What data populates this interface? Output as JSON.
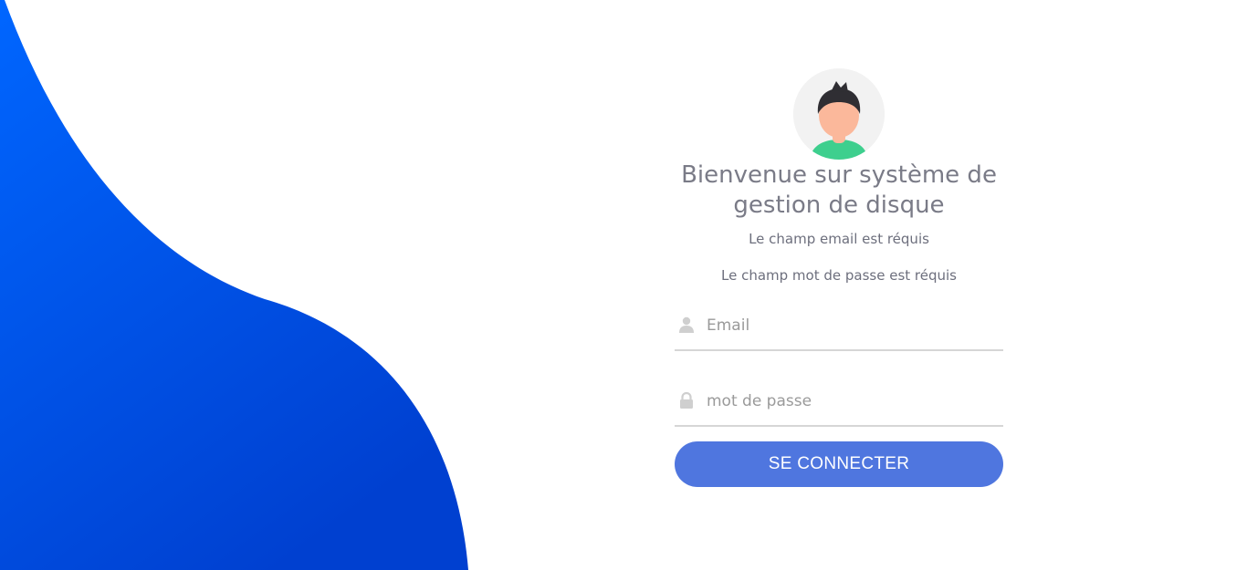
{
  "colors": {
    "wave_light": "#0066ff",
    "wave_dark": "#0040d0",
    "button": "#4f76df",
    "title_text": "#7a7b87",
    "input_border": "#d6d6d6",
    "avatar_bg": "#f2f2f2",
    "avatar_skin": "#fbb89b",
    "avatar_hair": "#2f2e33",
    "avatar_shirt": "#3ecf8e"
  },
  "login": {
    "avatar_icon": "user-avatar-icon",
    "title": "Bienvenue sur système de gestion de disque",
    "errors": {
      "email": "Le champ email est réquis",
      "password": "Le champ mot de passe est réquis"
    },
    "email": {
      "icon": "user-icon",
      "placeholder": "Email",
      "value": ""
    },
    "password": {
      "icon": "lock-icon",
      "placeholder": "mot de passe",
      "value": ""
    },
    "submit_label": "SE CONNECTER"
  }
}
